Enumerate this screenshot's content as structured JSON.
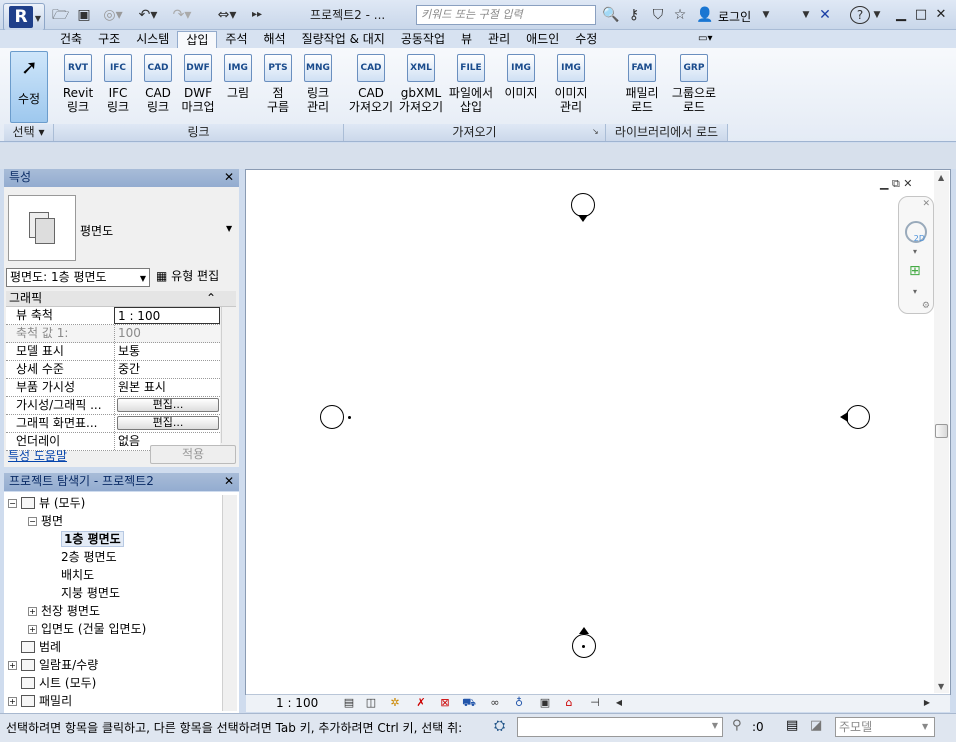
{
  "titlebar": {
    "app_icon": "revit-r-logo-icon",
    "app_letter": "R",
    "doc_title": "프로젝트2 - ...",
    "search_placeholder": "키워드 또는 구절 입력",
    "login_label": "로그인",
    "help_label": "?"
  },
  "tabs": [
    "건축",
    "구조",
    "시스템",
    "삽입",
    "주석",
    "해석",
    "질량작업 & 대지",
    "공동작업",
    "뷰",
    "관리",
    "애드인",
    "수정"
  ],
  "active_tab": "삽입",
  "ribbon": {
    "select": {
      "label": "수정",
      "group": "선택"
    },
    "link_group": {
      "label": "링크",
      "buttons": [
        {
          "line1": "Revit",
          "line2": "링크",
          "icon": "RVT"
        },
        {
          "line1": "IFC",
          "line2": "링크",
          "icon": "IFC"
        },
        {
          "line1": "CAD",
          "line2": "링크",
          "icon": "CAD"
        },
        {
          "line1": "DWF",
          "line2": "마크업",
          "icon": "DWF"
        },
        {
          "line1": "그림",
          "line2": "",
          "icon": "IMG"
        },
        {
          "line1": "점",
          "line2": "구름",
          "icon": "PTS"
        },
        {
          "line1": "링크",
          "line2": "관리",
          "icon": "MNG"
        }
      ]
    },
    "import_group": {
      "label": "가져오기",
      "buttons": [
        {
          "line1": "CAD",
          "line2": "가져오기",
          "icon": "CAD"
        },
        {
          "line1": "gbXML",
          "line2": "가져오기",
          "icon": "XML"
        },
        {
          "line1": "파일에서",
          "line2": "삽입",
          "icon": "FILE"
        },
        {
          "line1": "이미지",
          "line2": "",
          "icon": "IMG"
        },
        {
          "line1": "이미지",
          "line2": "관리",
          "icon": "IMG"
        }
      ]
    },
    "library_group": {
      "label": "라이브러리에서 로드",
      "buttons": [
        {
          "line1": "패밀리",
          "line2": "로드",
          "icon": "FAM"
        },
        {
          "line1": "그룹으로",
          "line2": "로드",
          "icon": "GRP"
        }
      ]
    }
  },
  "properties": {
    "title": "특성",
    "type_name": "평면도",
    "view_selector": "평면도: 1층 평면도",
    "edit_type": "유형 편집",
    "group_header": "그래픽",
    "rows": [
      {
        "key": "뷰 축척",
        "value": "1 : 100"
      },
      {
        "key": "축척 값    1:",
        "value": "100"
      },
      {
        "key": "모델 표시",
        "value": "보통"
      },
      {
        "key": "상세 수준",
        "value": "중간"
      },
      {
        "key": "부품 가시성",
        "value": "원본 표시"
      },
      {
        "key": "가시성/그래픽 ...",
        "value": "편집..."
      },
      {
        "key": "그래픽 화면표...",
        "value": "편집..."
      },
      {
        "key": "언더레이",
        "value": "없음"
      }
    ],
    "help_link": "특성 도움말",
    "apply_label": "적용"
  },
  "browser": {
    "title": "프로젝트 탐색기 - 프로젝트2",
    "items": [
      {
        "label": "뷰 (모두)",
        "level": 0,
        "toggle": "−"
      },
      {
        "label": "평면",
        "level": 1,
        "toggle": "−"
      },
      {
        "label": "1층 평면도",
        "level": 2,
        "toggle": ""
      },
      {
        "label": "2층 평면도",
        "level": 2,
        "toggle": ""
      },
      {
        "label": "배치도",
        "level": 2,
        "toggle": ""
      },
      {
        "label": "지붕 평면도",
        "level": 2,
        "toggle": ""
      },
      {
        "label": "천장 평면도",
        "level": 1,
        "toggle": "+"
      },
      {
        "label": "입면도 (건물 입면도)",
        "level": 1,
        "toggle": "+"
      },
      {
        "label": "범례",
        "level": 0,
        "toggle": ""
      },
      {
        "label": "일람표/수량",
        "level": 0,
        "toggle": "+"
      },
      {
        "label": "시트 (모두)",
        "level": 0,
        "toggle": ""
      },
      {
        "label": "패밀리",
        "level": 0,
        "toggle": "+"
      }
    ],
    "selected": "1층 평면도"
  },
  "viewcontrol": {
    "scale": "1 : 100"
  },
  "status": {
    "text": "선택하려면 항목을 클릭하고, 다른 항목을 선택하려면 Tab 키, 추가하려면 Ctrl 키, 선택 취:",
    "selection_count": ":0",
    "main_model": "주모델"
  }
}
